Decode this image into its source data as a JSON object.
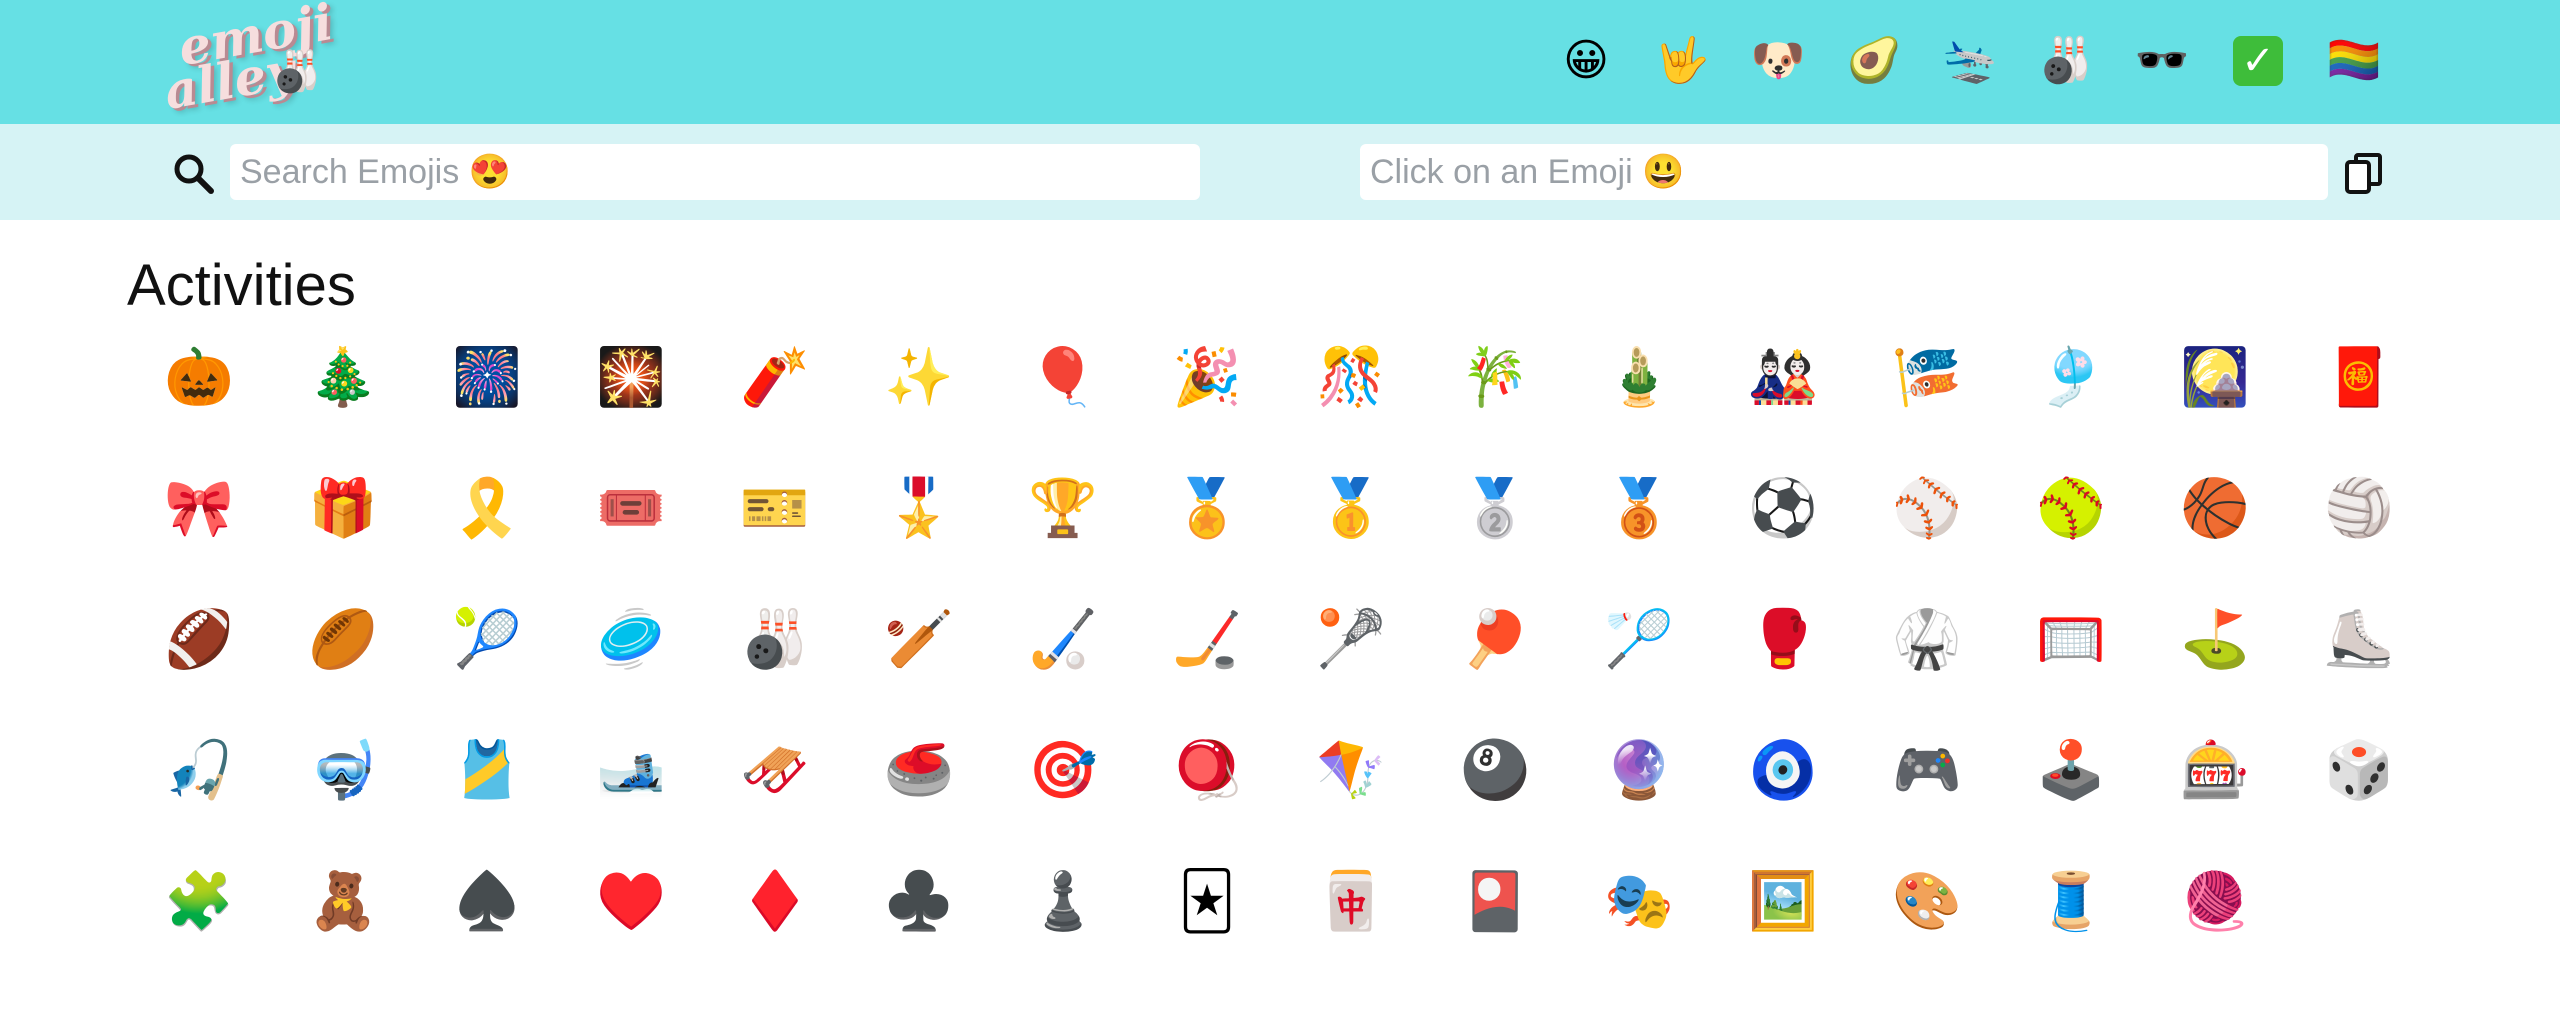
{
  "logo": {
    "line1": "emoji",
    "line2": "alley",
    "ball": "🎳"
  },
  "categories": [
    "😀",
    "🤟",
    "🐶",
    "🥑",
    "🛬",
    "🎳",
    "🕶️",
    "✅",
    "🏳️‍🌈"
  ],
  "search": {
    "placeholder": "Search Emojis 😍"
  },
  "output": {
    "placeholder": "Click on an Emoji 😃"
  },
  "section": {
    "title": "Activities"
  },
  "emojis": [
    "🎃",
    "🎄",
    "🎆",
    "🎇",
    "🧨",
    "✨",
    "🎈",
    "🎉",
    "🎊",
    "🎋",
    "🎍",
    "🎎",
    "🎏",
    "🎐",
    "🎑",
    "🧧",
    "🎀",
    "🎁",
    "🎗️",
    "🎟️",
    "🎫",
    "🎖️",
    "🏆",
    "🏅",
    "🥇",
    "🥈",
    "🥉",
    "⚽",
    "⚾",
    "🥎",
    "🏀",
    "🏐",
    "🏈",
    "🏉",
    "🎾",
    "🥏",
    "🎳",
    "🏏",
    "🏑",
    "🏒",
    "🥍",
    "🏓",
    "🏸",
    "🥊",
    "🥋",
    "🥅",
    "⛳",
    "⛸️",
    "🎣",
    "🤿",
    "🎽",
    "🎿",
    "🛷",
    "🥌",
    "🎯",
    "🪀",
    "🪁",
    "🎱",
    "🔮",
    "🧿",
    "🎮",
    "🕹️",
    "🎰",
    "🎲",
    "🧩",
    "🧸",
    "♠️",
    "♥️",
    "♦️",
    "♣️",
    "♟️",
    "🃏",
    "🀄",
    "🎴",
    "🎭",
    "🖼️",
    "🎨",
    "🧵",
    "🧶"
  ]
}
